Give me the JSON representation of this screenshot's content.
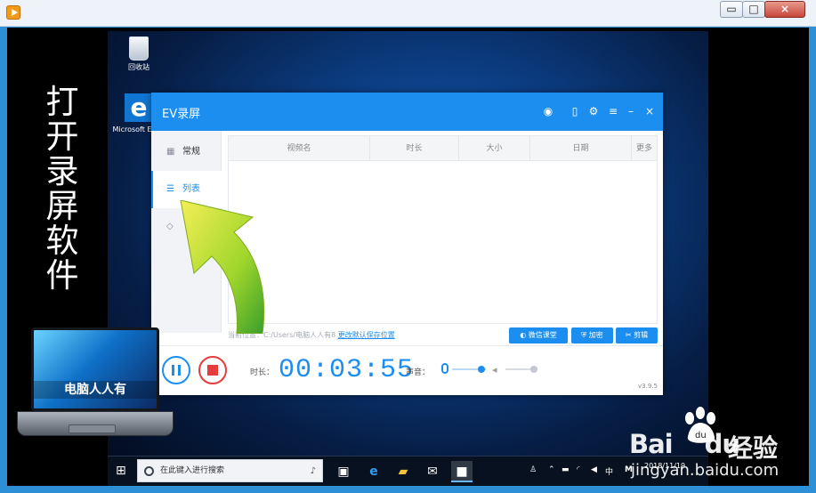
{
  "host": {
    "controls": {
      "minimize": "▭",
      "maximize": "□",
      "close": "×"
    }
  },
  "desktop": {
    "recycle_label": "回收站",
    "edge_label": "Microsoft Edge"
  },
  "ev": {
    "title": "EV录屏",
    "sidebar": [
      {
        "label": "常规",
        "icon": "grid-icon"
      },
      {
        "label": "列表",
        "icon": "list-icon"
      },
      {
        "label": "",
        "icon": "diamond-icon"
      }
    ],
    "table_headers": [
      "视频名",
      "时长",
      "大小",
      "日期",
      "更多"
    ],
    "path_prefix": "当前位置：",
    "path_value": "C:/Users/电脑人人有8",
    "path_link": "更改默认保存位置",
    "buttons": {
      "course": "微信课堂",
      "encrypt": "加密",
      "clip": "剪辑"
    },
    "duration_label": "时长：",
    "duration_value": "00:03:55",
    "sound_label": "声音：",
    "version": "v3.9.5"
  },
  "side_title": "打开录屏软件",
  "laptop": {
    "label": "电脑人人有"
  },
  "taskbar": {
    "search_placeholder": "在此键入进行搜索",
    "ime": "中",
    "ime_mode": "M",
    "date": "2018/11/19"
  },
  "watermark": {
    "brand": "Bai",
    "brand_suffix": "du",
    "experience": "经验",
    "url": "jingyan.baidu.com"
  }
}
